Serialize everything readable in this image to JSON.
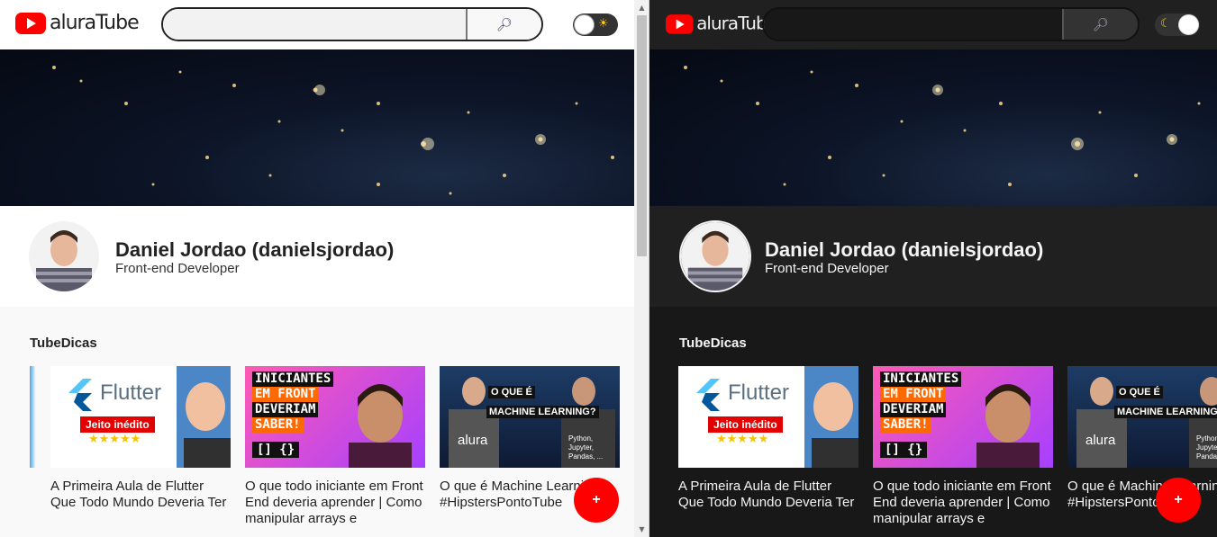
{
  "brand": {
    "logo_text": "aluraTube",
    "play_color": "#ff0000"
  },
  "search": {
    "placeholder": "",
    "button_icon": "magnifier-icon"
  },
  "theme_toggle": {
    "light_glyph": "☀",
    "dark_glyph": "☾"
  },
  "profile": {
    "name": "Daniel Jordao (danielsjordao)",
    "role": "Front-end Developer"
  },
  "playlist": {
    "title": "TubeDicas",
    "videos": [
      {
        "title": "A Primeira Aula de Flutter Que Todo Mundo Deveria Ter",
        "thumb_text": "Flutter",
        "thumb_badge": "Jeito inédito",
        "thumb_stars": "★★★★★"
      },
      {
        "title": "O que todo iniciante em Front End deveria aprender | Como manipular arrays e",
        "thumb_lines": [
          "INICIANTES",
          "EM FRONT",
          "DEVERIAM",
          "SABER!"
        ],
        "thumb_code": "[] {}"
      },
      {
        "title": "O que é Machine Learning? #HipstersPontoTube",
        "thumb_q1": "O QUE É",
        "thumb_q2": "MACHINE LEARNING?",
        "thumb_brand": "alura",
        "thumb_shirt": "Python, Jupyter, Pandas, ..."
      }
    ]
  },
  "fab": {
    "label": "+"
  },
  "colors": {
    "accent": "#ff0000",
    "dark_bg": "#181818",
    "light_bg": "#f9f9f9"
  }
}
